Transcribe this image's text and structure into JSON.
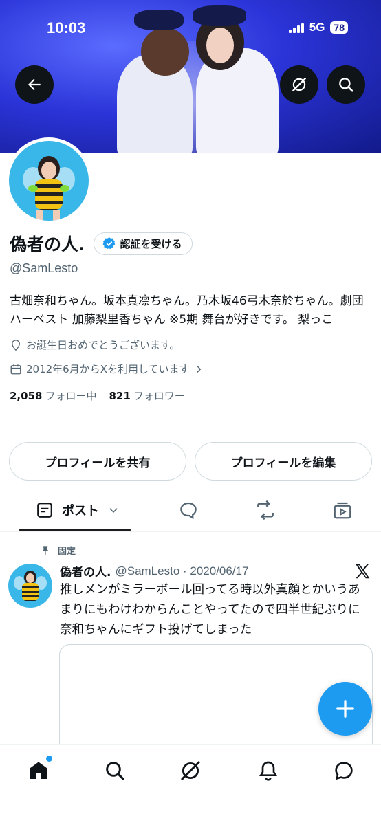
{
  "status_bar": {
    "time": "10:03",
    "network": "5G",
    "battery": "78"
  },
  "profile": {
    "name": "偽者の人.",
    "verify_label": "認証を受ける",
    "handle": "@SamLesto",
    "bio": "古畑奈和ちゃん。坂本真凛ちゃん。乃木坂46弓木奈於ちゃん。劇団ハーベスト 加藤梨里香ちゃん ※5期 舞台が好きです。 梨っこ",
    "birthday_text": "お誕生日おめでとうございます。",
    "joined_text": "2012年6月からXを利用しています",
    "following_count": "2,058",
    "following_label": "フォロー中",
    "followers_count": "821",
    "followers_label": "フォロワー"
  },
  "buttons": {
    "share_profile": "プロフィールを共有",
    "edit_profile": "プロフィールを編集"
  },
  "tabs": {
    "posts_label": "ポスト"
  },
  "pinned_post": {
    "pinned_label": "固定",
    "author_name": "偽者の人.",
    "meta": "@SamLesto · 2020/06/17",
    "text": "推しメンがミラーボール回ってる時以外真顔とかいうあまりにもわけわからんことやってたので四半世紀ぶりに奈和ちゃんにギフト投げてしまった"
  },
  "colors": {
    "accent": "#1d9bf0",
    "banner": "#2b34d8",
    "text": "#0f1419",
    "secondary": "#536471"
  },
  "icons": [
    "back-arrow-icon",
    "grok-icon",
    "search-icon",
    "verified-badge-icon",
    "location-icon",
    "calendar-icon",
    "chevron-right-icon",
    "list-icon",
    "chevron-down-icon",
    "reply-icon",
    "repost-icon",
    "media-icon",
    "pin-icon",
    "x-logo-icon",
    "plus-icon",
    "home-icon",
    "bell-icon",
    "messages-icon"
  ]
}
